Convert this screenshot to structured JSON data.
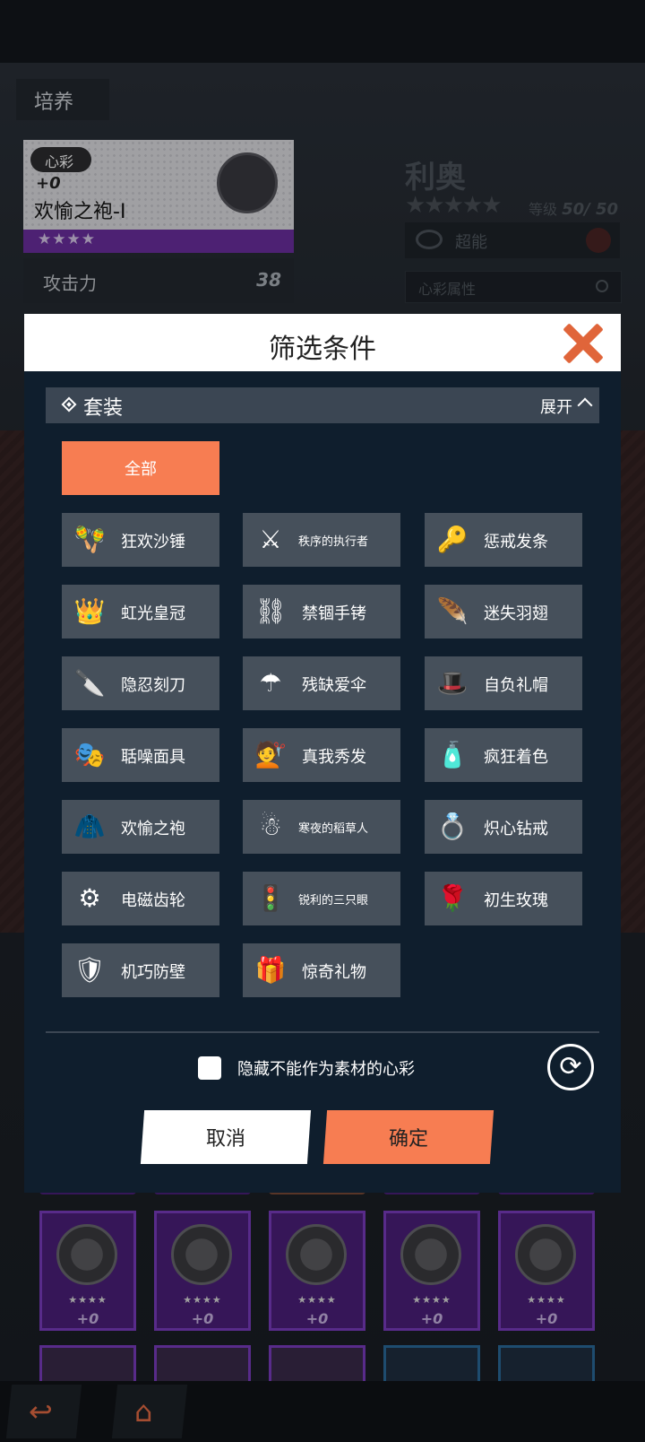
{
  "screen": {
    "section_tab": "培养",
    "card": {
      "badge": "心彩",
      "plus": "+0",
      "name": "欢愉之袍-I",
      "stars": "★★★★",
      "stat_label": "攻击力",
      "stat_value": "38"
    },
    "character": {
      "name": "利奥",
      "stars": "★★★★★",
      "level_label": "等级",
      "level_value": "50/ 50",
      "role": "超能",
      "attr_search_placeholder": "心彩属性"
    },
    "inventory": {
      "stars": "★★★★",
      "plus": "+0"
    },
    "nav": {
      "back_icon": "back-arrow-icon",
      "home_icon": "home-icon"
    }
  },
  "modal": {
    "title": "筛选条件",
    "section": {
      "title": "套装",
      "expand_label": "展开"
    },
    "all_label": "全部",
    "sets": [
      {
        "label": "狂欢沙锤",
        "icon": "maraca-icon",
        "glyph": "🪇"
      },
      {
        "label": "秩序的执行者",
        "icon": "scythe-icon",
        "glyph": "⚔"
      },
      {
        "label": "惩戒发条",
        "icon": "windup-key-icon",
        "glyph": "🔑"
      },
      {
        "label": "虹光皇冠",
        "icon": "crown-icon",
        "glyph": "👑"
      },
      {
        "label": "禁锢手铐",
        "icon": "handcuffs-icon",
        "glyph": "⛓"
      },
      {
        "label": "迷失羽翅",
        "icon": "feather-wing-icon",
        "glyph": "🪶"
      },
      {
        "label": "隐忍刻刀",
        "icon": "knife-icon",
        "glyph": "🔪"
      },
      {
        "label": "残缺爱伞",
        "icon": "umbrella-icon",
        "glyph": "☂"
      },
      {
        "label": "自负礼帽",
        "icon": "top-hat-icon",
        "glyph": "🎩"
      },
      {
        "label": "聒噪面具",
        "icon": "mask-icon",
        "glyph": "🎭"
      },
      {
        "label": "真我秀发",
        "icon": "hair-icon",
        "glyph": "💇"
      },
      {
        "label": "疯狂着色",
        "icon": "spray-can-icon",
        "glyph": "🧴"
      },
      {
        "label": "欢愉之袍",
        "icon": "robe-icon",
        "glyph": "🧥"
      },
      {
        "label": "寒夜的稻草人",
        "icon": "scarecrow-icon",
        "glyph": "☃"
      },
      {
        "label": "炽心钻戒",
        "icon": "ring-icon",
        "glyph": "💍"
      },
      {
        "label": "电磁齿轮",
        "icon": "gear-icon",
        "glyph": "⚙"
      },
      {
        "label": "锐利的三只眼",
        "icon": "traffic-light-icon",
        "glyph": "🚦"
      },
      {
        "label": "初生玫瑰",
        "icon": "rose-icon",
        "glyph": "🌹"
      },
      {
        "label": "机巧防壁",
        "icon": "shield-glass-icon",
        "glyph": "🛡"
      },
      {
        "label": "惊奇礼物",
        "icon": "gift-icon",
        "glyph": "🎁"
      }
    ],
    "hide_label": "隐藏不能作为素材的心彩",
    "cancel_label": "取消",
    "confirm_label": "确定",
    "colors": {
      "accent": "#f77d52",
      "chip_bg": "#46505b",
      "modal_bg": "#0f1e2d",
      "close": "#e0653a"
    }
  }
}
